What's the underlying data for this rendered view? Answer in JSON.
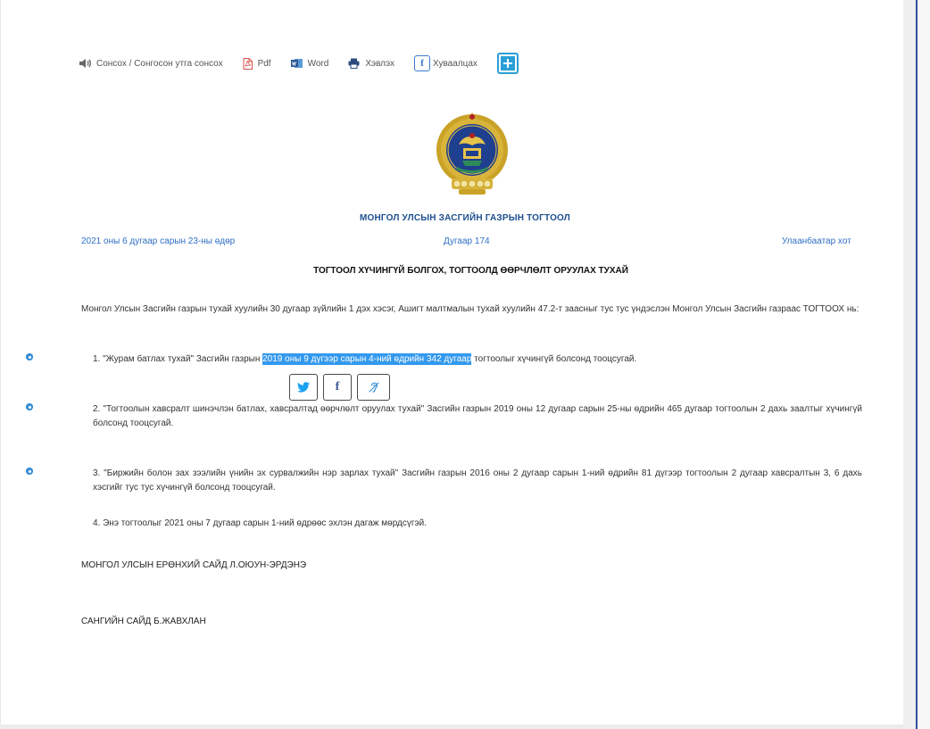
{
  "toolbar": {
    "listen_label": "Сонсох / Сонгосон утга сонсох",
    "pdf_label": "Pdf",
    "word_label": "Word",
    "print_label": "Хэвлэх",
    "share_label": "Хуваалцах",
    "facebook_glyph": "f"
  },
  "header": {
    "gov_title": "МОНГОЛ УЛСЫН ЗАСГИЙН ГАЗРЫН ТОГТООЛ",
    "date": "2021 оны 6 дугаар сарын 23-ны өдөр",
    "number": "Дугаар 174",
    "place": "Улаанбаатар хот"
  },
  "document": {
    "title": "ТОГТООЛ ХҮЧИНГҮЙ БОЛГОХ, ТОГТООЛД ӨӨРЧЛӨЛТ ОРУУЛАХ ТУХАЙ",
    "intro": "Монгол Улсын Засгийн газрын тухай хуулийн 30 дугаар зүйлийн 1 дэх хэсэг, Ашигт малтмалын тухай хуулийн 47.2-т заасныг тус тус үндэслэн Монгол Улсын Засгийн газраас ТОГТООХ нь:",
    "item1_before": "1. \"Журам батлах тухай\" Засгийн газрын ",
    "item1_highlight": "2019 оны 9 дүгээр сарын 4-ний өдрийн 342 дугаар",
    "item1_after": " тогтоолыг хүчингүй болсонд тооцсугай.",
    "item2": "2. \"Тогтоолын хавсралт шинэчлэн батлах, хавсралтад өөрчлөлт оруулах тухай\" Засгийн газрын 2019 оны 12 дугаар сарын 25-ны өдрийн 465 дугаар тогтоолын 2 дахь заалтыг хүчингүй болсонд тооцсугай.",
    "item3": "3. \"Биржийн болон зах зээлийн үнийн эх сурвалжийн нэр зарлах тухай\" Засгийн газрын  2016 оны 2 дугаар сарын 1-ний өдрийн 81 дүгээр тогтоолын 2 дугаар хавсралтын 3, 6 дахь хэсгийг тус тус хүчингүй болсонд тооцсугай.",
    "item4": "4. Энэ тогтоолыг 2021 оны 7 дугаар сарын 1-ний өдрөөс эхлэн дагаж мөрдсүгэй.",
    "signature1": "МОНГОЛ УЛСЫН ЕРӨНХИЙ САЙД Л.ОЮУН-ЭРДЭНЭ",
    "signature2": "САНГИЙН САЙД Б.ЖАВХЛАН"
  },
  "share_popup": {
    "twitter_icon": "twitter-icon",
    "facebook_glyph": "f",
    "listen_icon": "hearing-icon"
  },
  "colors": {
    "link_blue": "#2f6fc4",
    "title_blue": "#1e4f8e",
    "highlight": "#3399ee",
    "accent": "#2a9fd6"
  }
}
